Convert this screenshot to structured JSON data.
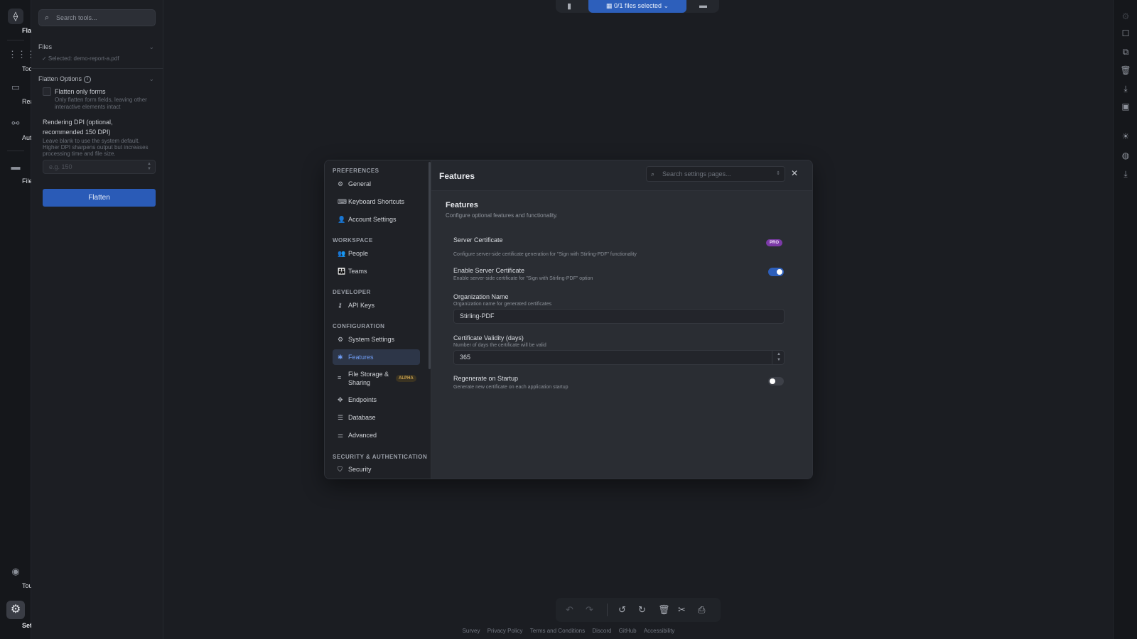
{
  "left_rail": {
    "items": [
      {
        "label": "Flatten",
        "icon": "flatten-icon"
      },
      {
        "label": "Tools",
        "icon": "grid-icon"
      },
      {
        "label": "Reader",
        "icon": "book-icon"
      },
      {
        "label": "Automate",
        "icon": "automate-icon"
      },
      {
        "label": "Files",
        "icon": "folder-icon"
      },
      {
        "label": "Tours",
        "icon": "compass-icon"
      },
      {
        "label": "Settings",
        "icon": "gear-icon"
      }
    ]
  },
  "tool_panel": {
    "search_placeholder": "Search tools...",
    "files_label": "Files",
    "selected_file": "✓ Selected: demo-report-a.pdf",
    "options_label": "Flatten Options",
    "checkbox_label": "Flatten only forms",
    "checkbox_desc_1": "Only flatten form fields, leaving other",
    "checkbox_desc_2": "interactive elements intact",
    "dpi_label_1": "Rendering DPI (optional,",
    "dpi_label_2": "recommended 150 DPI)",
    "dpi_desc_1": "Leave blank to use the system default.",
    "dpi_desc_2": "Higher DPI sharpens output but increases",
    "dpi_desc_3": "processing time and file size.",
    "dpi_placeholder": "e.g. 150",
    "flatten_button": "Flatten"
  },
  "top_bar": {
    "files_selected": "0/1 files selected"
  },
  "modal": {
    "nav": {
      "preferences": "PREFERENCES",
      "general": "General",
      "keyboard_shortcuts": "Keyboard Shortcuts",
      "account_settings": "Account Settings",
      "workspace": "WORKSPACE",
      "people": "People",
      "teams": "Teams",
      "developer": "DEVELOPER",
      "api_keys": "API Keys",
      "configuration": "CONFIGURATION",
      "system_settings": "System Settings",
      "features": "Features",
      "file_storage_1": "File Storage &",
      "file_storage_2": "Sharing",
      "alpha_badge": "ALPHA",
      "endpoints": "Endpoints",
      "database": "Database",
      "advanced": "Advanced",
      "security_auth": "SECURITY & AUTHENTICATION",
      "security": "Security"
    },
    "title": "Features",
    "search_placeholder": "Search settings pages...",
    "section_title": "Features",
    "section_desc": "Configure optional features and functionality.",
    "server_certificate": {
      "label": "Server Certificate",
      "badge": "PRO",
      "desc": "Configure server-side certificate generation for \"Sign with Stirling-PDF\" functionality"
    },
    "enable_cert": {
      "label": "Enable Server Certificate",
      "desc": "Enable server-side certificate for \"Sign with Stirling-PDF\" option",
      "enabled": true
    },
    "org_name": {
      "label": "Organization Name",
      "desc": "Organization name for generated certificates",
      "value": "Stirling-PDF"
    },
    "validity": {
      "label": "Certificate Validity (days)",
      "desc": "Number of days the certificate will be valid",
      "value": "365"
    },
    "regenerate": {
      "label": "Regenerate on Startup",
      "desc": "Generate new certificate on each application startup",
      "enabled": false
    }
  },
  "footer": {
    "links": [
      "Survey",
      "Privacy Policy",
      "Terms and Conditions",
      "Discord",
      "GitHub",
      "Accessibility"
    ]
  },
  "colors": {
    "accent": "#2d5fbb",
    "pro_badge": "#7c3aa8",
    "alpha_badge": "#c9a14f"
  }
}
